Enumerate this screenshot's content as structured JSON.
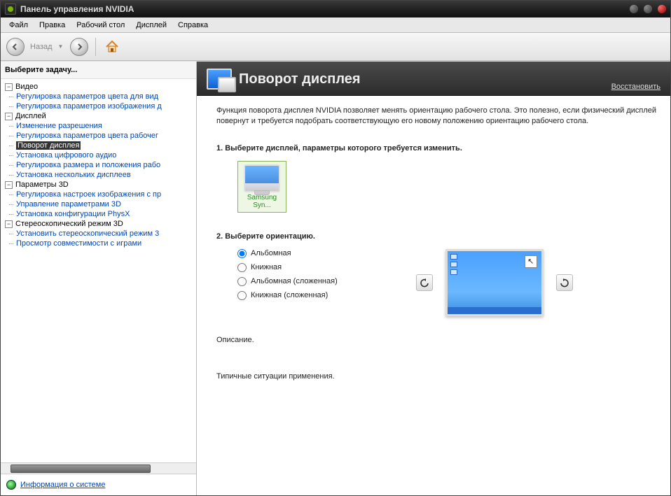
{
  "titlebar": {
    "title": "Панель управления NVIDIA"
  },
  "menu": {
    "items": [
      "Файл",
      "Правка",
      "Рабочий стол",
      "Дисплей",
      "Справка"
    ]
  },
  "toolbar": {
    "back_label": "Назад"
  },
  "sidebar": {
    "task_header": "Выберите задачу...",
    "groups": [
      {
        "label": "Видео",
        "items": [
          "Регулировка параметров цвета для вид",
          "Регулировка параметров изображения д"
        ]
      },
      {
        "label": "Дисплей",
        "items": [
          "Изменение разрешения",
          "Регулировка параметров цвета рабочег",
          "Поворот дисплея",
          "Установка цифрового аудио",
          "Регулировка размера и положения рабо",
          "Установка нескольких дисплеев"
        ],
        "selected_index": 2
      },
      {
        "label": "Параметры 3D",
        "items": [
          "Регулировка настроек изображения с пр",
          "Управление параметрами 3D",
          "Установка конфигурации PhysX"
        ]
      },
      {
        "label": "Стереоскопический режим 3D",
        "items": [
          "Установить стереоскопический режим 3",
          "Просмотр совместимости с играми"
        ]
      }
    ],
    "sysinfo_label": "Информация о системе"
  },
  "content": {
    "title": "Поворот дисплея",
    "restore": "Восстановить",
    "intro": "Функция поворота дисплея NVIDIA позволяет менять ориентацию рабочего стола. Это полезно, если физический дисплей повернут и требуется подобрать соответствующую его новому положению ориентацию рабочего стола.",
    "step1": "1. Выберите дисплей, параметры которого требуется изменить.",
    "display_label": "Samsung Syn...",
    "step2": "2. Выберите ориентацию.",
    "radios": [
      "Альбомная",
      "Книжная",
      "Альбомная (сложенная)",
      "Книжная (сложенная)"
    ],
    "selected_radio": 0,
    "desc": "Описание.",
    "typical": "Типичные ситуации применения."
  }
}
